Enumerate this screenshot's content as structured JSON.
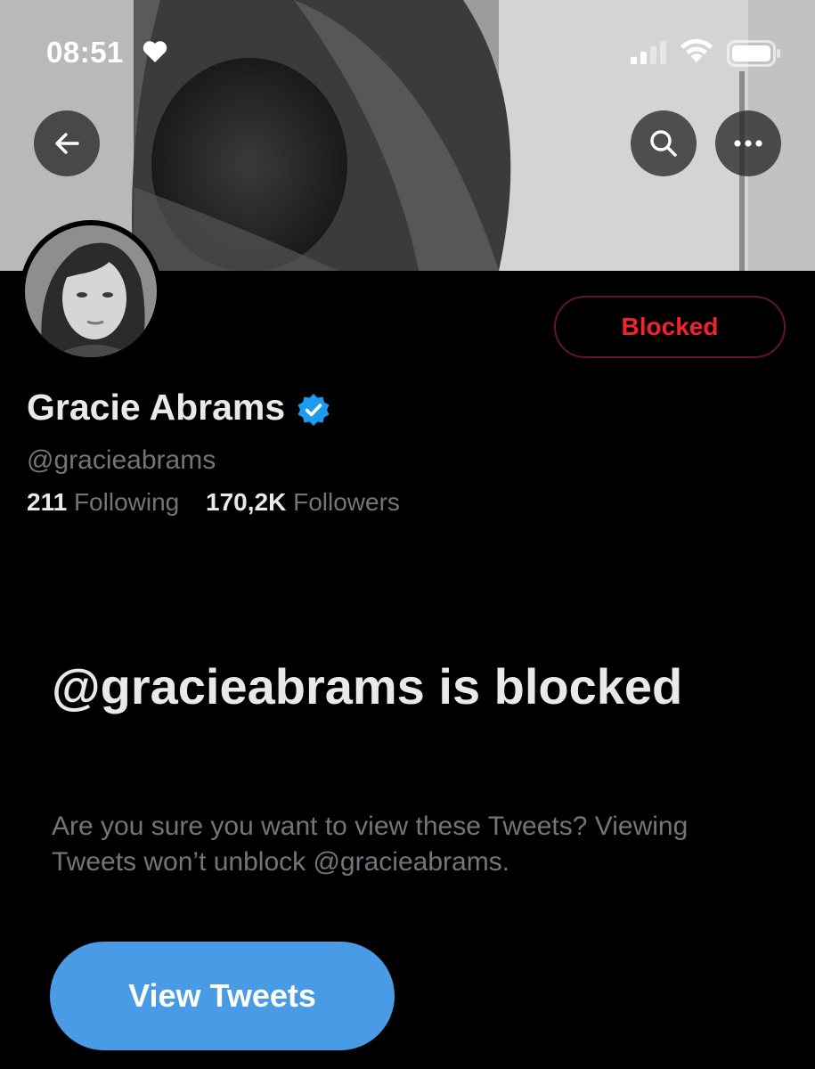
{
  "status_bar": {
    "time": "08:51",
    "icons": [
      "heart-icon",
      "cellular-signal-icon",
      "wifi-icon",
      "battery-icon"
    ]
  },
  "header": {
    "back_icon": "arrow-left-icon",
    "search_icon": "search-icon",
    "more_icon": "more-horizontal-icon"
  },
  "profile": {
    "name": "Gracie Abrams",
    "verified_icon": "verified-badge-icon",
    "handle": "@gracieabrams",
    "following_count": "211",
    "following_label": "Following",
    "followers_count": "170,2K",
    "followers_label": "Followers",
    "relationship_button": "Blocked"
  },
  "blocked_notice": {
    "title": "@gracieabrams is blocked",
    "description": "Are you sure you want to view these Tweets? Viewing Tweets won’t unblock @gracieabrams.",
    "view_button": "View Tweets"
  },
  "colors": {
    "background": "#000000",
    "primary_text": "#e7e9ea",
    "secondary_text": "#71767b",
    "blocked_red": "#f4212e",
    "accent_blue": "#4a9be6",
    "verified_blue": "#1d9bf0"
  }
}
